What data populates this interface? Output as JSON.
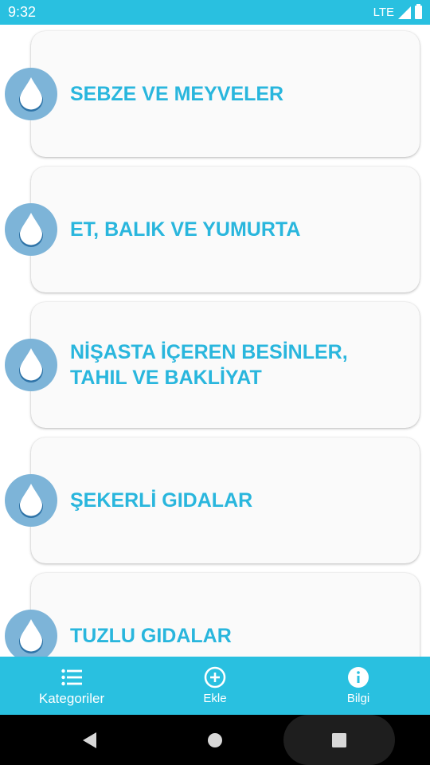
{
  "status_bar": {
    "time": "9:32",
    "network": "LTE"
  },
  "categories": [
    {
      "label": "SEBZE VE MEYVELER",
      "icon": "water-drop-icon"
    },
    {
      "label": "ET, BALIK VE YUMURTA",
      "icon": "water-drop-icon"
    },
    {
      "label": "NİŞASTA İÇEREN BESİNLER, TAHIL VE BAKLİYAT",
      "icon": "water-drop-icon"
    },
    {
      "label": "ŞEKERLİ GIDALAR",
      "icon": "water-drop-icon"
    },
    {
      "label": "TUZLU GIDALAR",
      "icon": "water-drop-icon"
    }
  ],
  "bottom_nav": {
    "items": [
      {
        "label": "Kategoriler",
        "icon": "list-icon",
        "active": true
      },
      {
        "label": "Ekle",
        "icon": "add-circle-icon",
        "active": false
      },
      {
        "label": "Bilgi",
        "icon": "info-icon",
        "active": false
      }
    ]
  },
  "colors": {
    "primary": "#29c0e0",
    "label_text": "#29b6dd",
    "badge": "#7db4d8",
    "card_bg": "#fafafa"
  }
}
